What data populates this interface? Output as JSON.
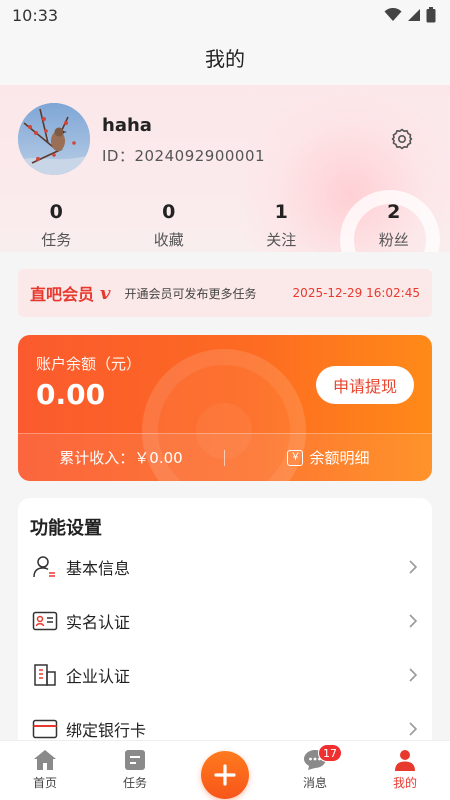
{
  "status_bar": {
    "time": "10:33"
  },
  "header": {
    "title": "我的"
  },
  "profile": {
    "username": "haha",
    "user_id": "ID：2024092900001",
    "stats": [
      {
        "value": "0",
        "label": "任务"
      },
      {
        "value": "0",
        "label": "收藏"
      },
      {
        "value": "1",
        "label": "关注"
      },
      {
        "value": "2",
        "label": "粉丝"
      }
    ]
  },
  "vip": {
    "title": "直吧会员",
    "mark": "v",
    "desc": "开通会员可发布更多任务",
    "expire": "2025-12-29 16:02:45"
  },
  "balance": {
    "label": "账户余额（元）",
    "amount": "0.00",
    "withdraw_label": "申请提现",
    "income_label": "累计收入：￥0.00",
    "detail_label": "余额明细",
    "detail_icon_glyph": "￥"
  },
  "functions": {
    "title": "功能设置",
    "items": [
      {
        "label": "基本信息",
        "icon": "user-info-icon"
      },
      {
        "label": "实名认证",
        "icon": "id-card-icon"
      },
      {
        "label": "企业认证",
        "icon": "building-icon"
      },
      {
        "label": "绑定银行卡",
        "icon": "bank-card-icon"
      }
    ]
  },
  "tabbar": {
    "items": [
      {
        "label": "首页",
        "icon": "home-icon"
      },
      {
        "label": "任务",
        "icon": "task-icon"
      },
      {
        "label": "",
        "icon": "plus-icon"
      },
      {
        "label": "消息",
        "icon": "message-icon",
        "badge": "17"
      },
      {
        "label": "我的",
        "icon": "profile-icon",
        "active": true
      }
    ]
  },
  "colors": {
    "accent": "#e8392f",
    "balance_gradient_start": "#fb5a2e",
    "balance_gradient_end": "#ff8a18"
  }
}
